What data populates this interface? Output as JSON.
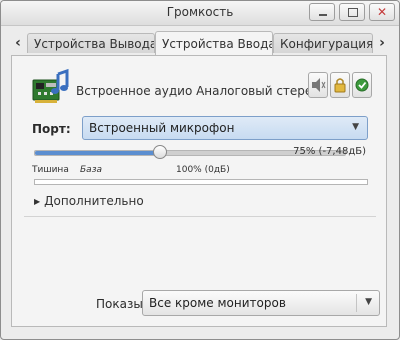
{
  "window": {
    "title": "Громкость"
  },
  "tabs": [
    {
      "label": "Устройства Вывода",
      "active": false
    },
    {
      "label": "Устройства Ввода",
      "active": true
    },
    {
      "label": "Конфигурация",
      "active": false
    }
  ],
  "device": {
    "name": "Встроенное аудио Аналоговый стерео",
    "icon": "sound-card-icon"
  },
  "port": {
    "label": "Порт:",
    "selected": "Встроенный микрофон"
  },
  "volume": {
    "level_percent": 40,
    "readout": "75% (-7,48дБ)",
    "marks": {
      "silence": "Тишина",
      "base": "База",
      "full": "100% (0дБ)"
    }
  },
  "advanced": {
    "label": "Дополнительно"
  },
  "show": {
    "label": "Показывать:",
    "selected": "Все кроме мониторов"
  },
  "colors": {
    "accent": "#5b8ed0",
    "combo_highlight": "#c7dbf1",
    "close": "#c43a3a"
  }
}
